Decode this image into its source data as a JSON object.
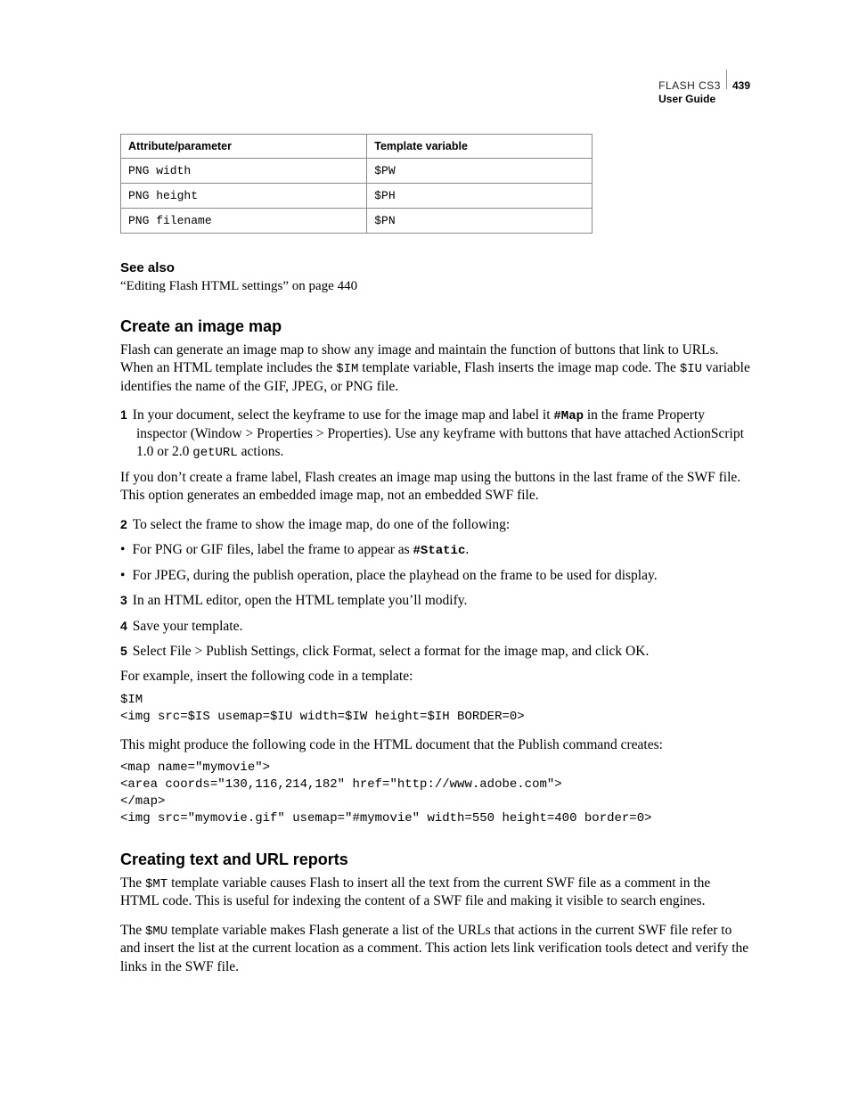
{
  "header": {
    "product": "FLASH CS3",
    "page_number": "439",
    "subtitle": "User Guide"
  },
  "table": {
    "head": {
      "c0": "Attribute/parameter",
      "c1": "Template variable"
    },
    "rows": [
      {
        "c0": "PNG width",
        "c1": "$PW"
      },
      {
        "c0": "PNG height",
        "c1": "$PH"
      },
      {
        "c0": "PNG filename",
        "c1": "$PN"
      }
    ]
  },
  "see_also": {
    "title": "See also",
    "link": "“Editing Flash HTML settings” on page 440"
  },
  "s1": {
    "title": "Create an image map",
    "intro_a": "Flash can generate an image map to show any image and maintain the function of buttons that link to URLs. When an HTML template includes the ",
    "intro_code1": "$IM",
    "intro_b": " template variable, Flash inserts the image map code. The ",
    "intro_code2": "$IU",
    "intro_c": " variable identifies the name of the GIF, JPEG, or PNG file.",
    "step1_a": "In your document, select the keyframe to use for the image map and label it ",
    "step1_code": "#Map",
    "step1_b": " in the frame Property inspector (Window > Properties > Properties). Use any keyframe with buttons that have attached ActionScript 1.0 or 2.0 ",
    "step1_code2": "getURL",
    "step1_c": " actions.",
    "note1": "If you don’t create a frame label, Flash creates an image map using the buttons in the last frame of the SWF file. This option generates an embedded image map, not an embedded SWF file.",
    "step2": "To select the frame to show the image map, do one of the following:",
    "bullet1_a": "For PNG or GIF files, label the frame to appear as ",
    "bullet1_code": "#Static",
    "bullet1_b": ".",
    "bullet2": "For JPEG, during the publish operation, place the playhead on the frame to be used for display.",
    "step3": "In an HTML editor, open the HTML template you’ll modify.",
    "step4": "Save your template.",
    "step5": "Select File > Publish Settings, click Format, select a format for the image map, and click OK.",
    "example_lead": "For example, insert the following code in a template:",
    "code1": "$IM\n<img src=$IS usemap=$IU width=$IW height=$IH BORDER=0>",
    "example_lead2": "This might produce the following code in the HTML document that the Publish command creates:",
    "code2": "<map name=\"mymovie\">\n<area coords=\"130,116,214,182\" href=\"http://www.adobe.com\">\n</map>\n<img src=\"mymovie.gif\" usemap=\"#mymovie\" width=550 height=400 border=0>"
  },
  "s2": {
    "title": "Creating text and URL reports",
    "p1_a": "The ",
    "p1_code": "$MT",
    "p1_b": " template variable causes Flash to insert all the text from the current SWF file as a comment in the HTML code. This is useful for indexing the content of a SWF file and making it visible to search engines.",
    "p2_a": "The ",
    "p2_code": "$MU",
    "p2_b": " template variable makes Flash generate a list of the URLs that actions in the current SWF file refer to and insert the list at the current location as a comment. This action lets link verification tools detect and verify the links in the SWF file."
  }
}
